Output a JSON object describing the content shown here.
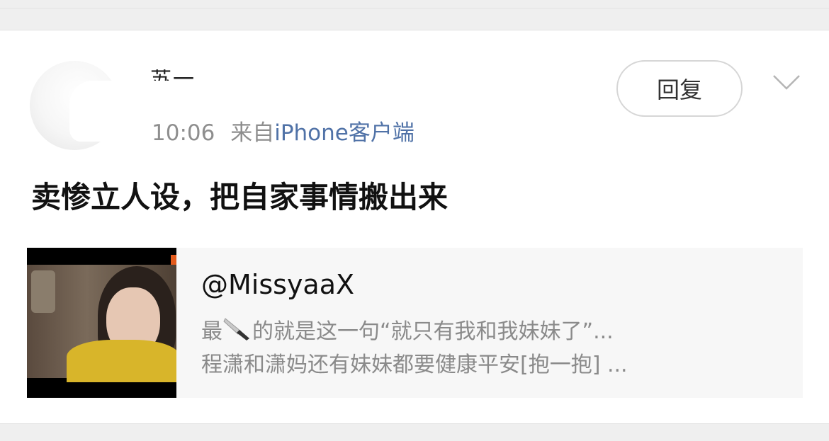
{
  "post": {
    "username": "苏一",
    "time": "10:06",
    "from_prefix": "来自",
    "source": "iPhone客户端",
    "reply_label": "回复",
    "text": "卖惨立人设，把自家事情搬出来"
  },
  "card": {
    "handle": "@MissyaaX",
    "line1_before": "最",
    "line1_icon": "knife-emoji",
    "line1_after": "的就是这一句“就只有我和我妹妹了”...",
    "line2": "程潇和潇妈还有妹妹都要健康平安[抱一抱] ..."
  }
}
